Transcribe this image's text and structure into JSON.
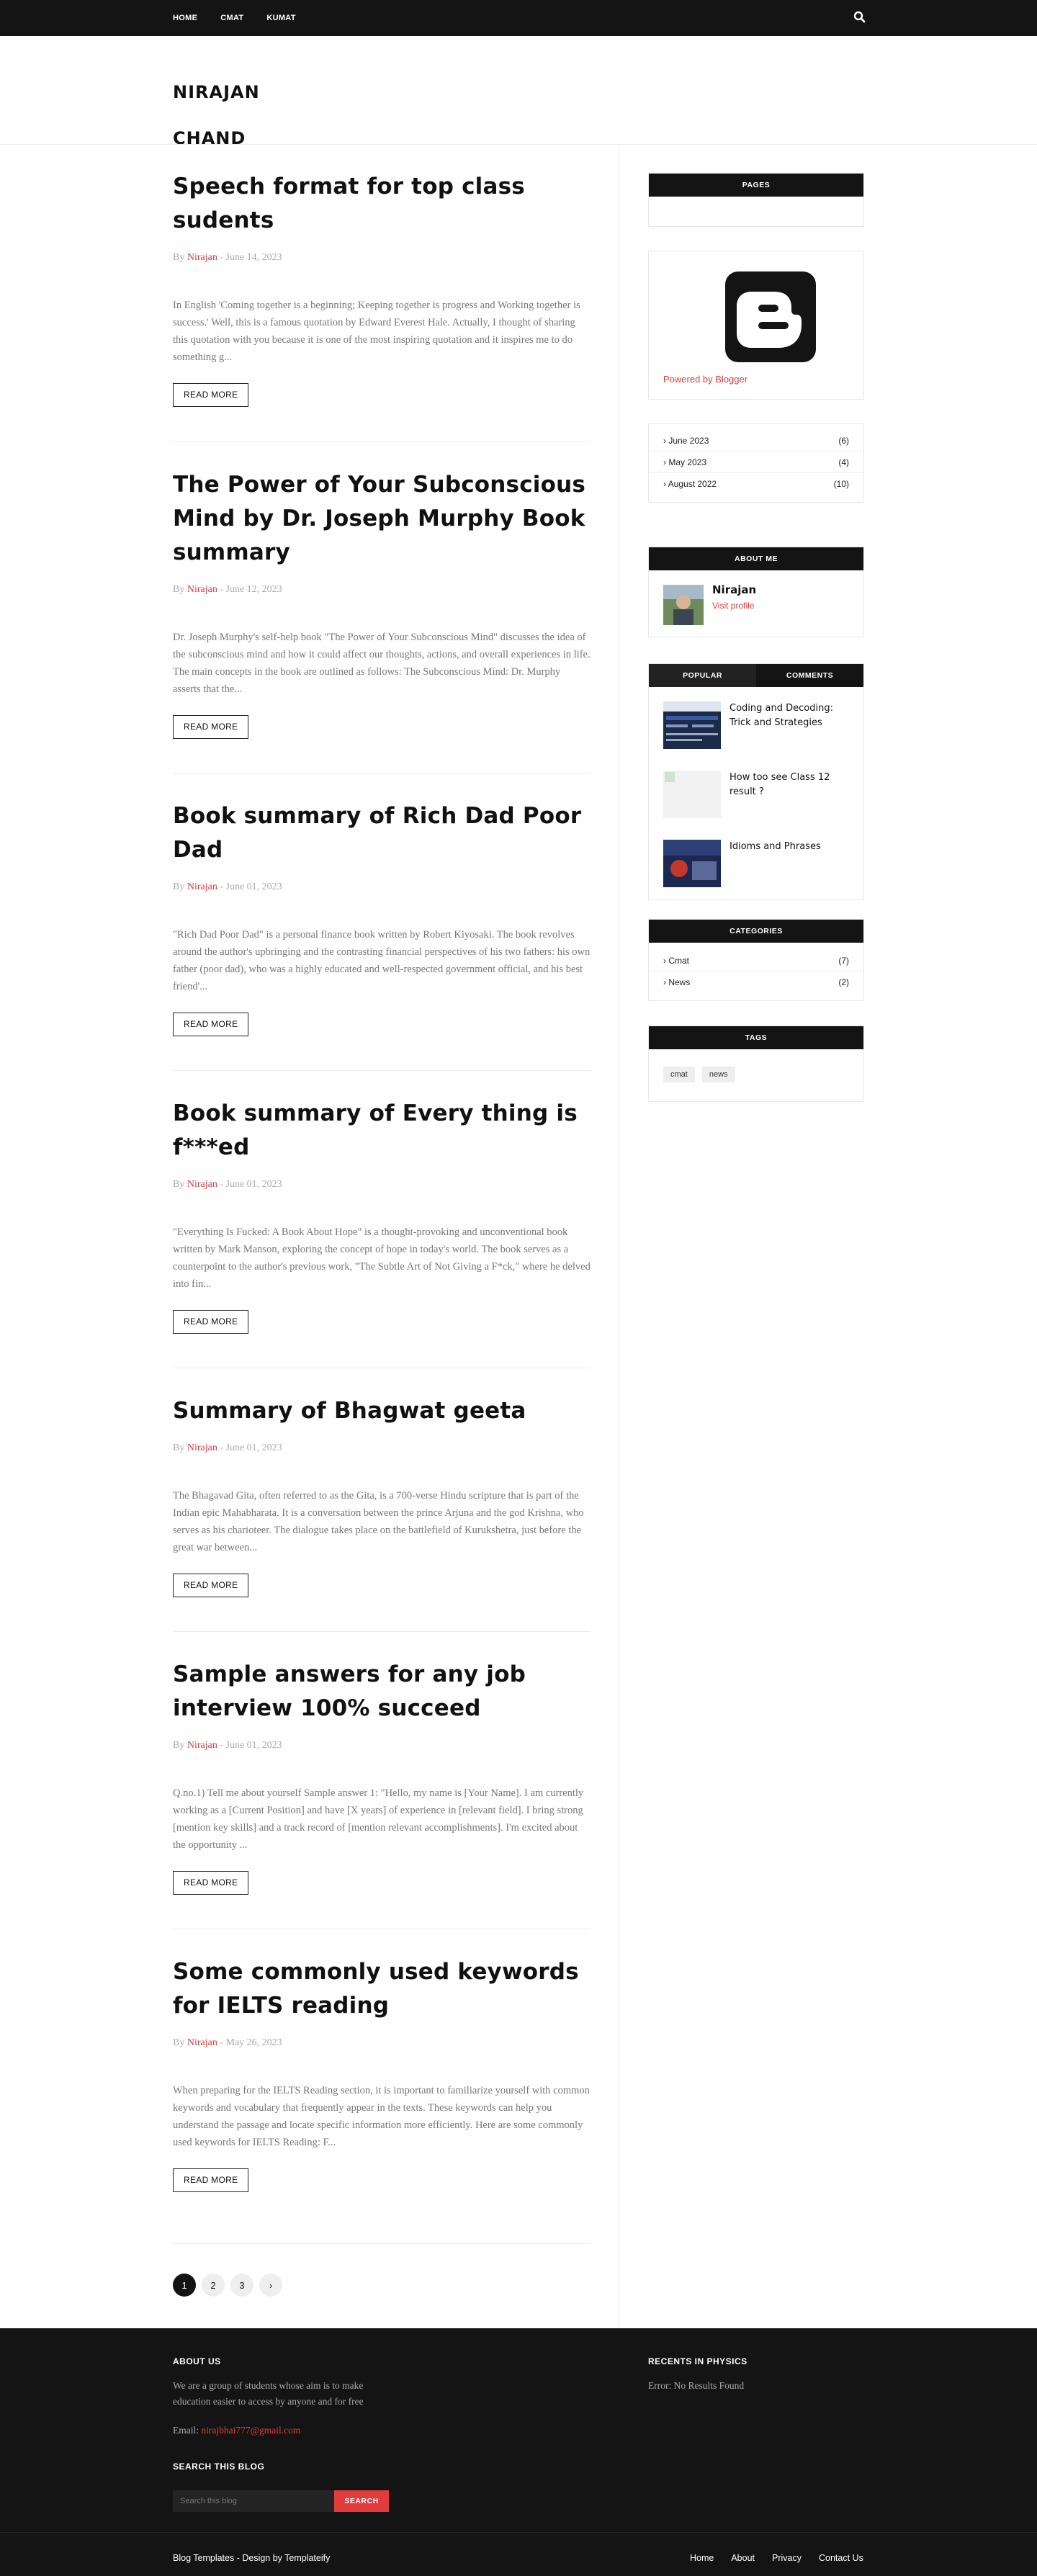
{
  "nav": {
    "items": [
      "HOME",
      "CMAT",
      "KUMAT"
    ],
    "search_icon": "search-icon"
  },
  "site": {
    "title_line1": "NIRAJAN",
    "title_line2": "CHAND"
  },
  "posts": [
    {
      "title": "Speech format for top class sudents",
      "by": "By ",
      "author": "Nirajan",
      "date": " - June 14, 2023",
      "excerpt": "In English 'Coming together is a beginning;  Keeping together is progress and Working together is success.' Well, this is a famous quotation by Edward Everest Hale. Actually, I thought of sharing this quotation with you because it is one of the most inspiring quotation and it inspires me to do something g...",
      "readmore": "READ MORE"
    },
    {
      "title": "The Power of Your Subconscious Mind by Dr. Joseph Murphy Book summary",
      "by": "By ",
      "author": "Nirajan",
      "date": " - June 12, 2023",
      "excerpt": "Dr. Joseph Murphy's self-help book \"The Power of Your Subconscious Mind\" discusses the idea of the subconscious mind and how it could affect our thoughts, actions, and overall experiences in life. The main concepts in the book are outlined as follows: The Subconscious Mind: Dr. Murphy asserts that the...",
      "readmore": "READ MORE"
    },
    {
      "title": "Book summary of Rich Dad Poor Dad",
      "by": "By ",
      "author": "Nirajan",
      "date": " - June 01, 2023",
      "excerpt": "\"Rich Dad Poor Dad\" is a personal finance book written by Robert Kiyosaki. The book revolves around the author's upbringing and the contrasting financial perspectives of his two fathers: his own father (poor dad), who was a highly educated and well-respected government official, and his best friend'...",
      "readmore": "READ MORE"
    },
    {
      "title": "Book summary of Every thing is f***ed",
      "by": "By ",
      "author": "Nirajan",
      "date": " - June 01, 2023",
      "excerpt": "\"Everything Is Fucked: A Book About Hope\" is a thought-provoking and unconventional book written by Mark Manson, exploring the concept of hope in today's world. The book serves as a counterpoint to the author's previous work, \"The Subtle Art of Not Giving a F*ck,\" where he delved into fin...",
      "readmore": "READ MORE"
    },
    {
      "title": "Summary of Bhagwat geeta",
      "by": "By ",
      "author": "Nirajan",
      "date": " - June 01, 2023",
      "excerpt": "The Bhagavad Gita, often referred to as the Gita, is a 700-verse Hindu scripture that is part of the Indian epic Mahabharata. It is a conversation between the prince Arjuna and the god Krishna, who serves as his charioteer. The dialogue takes place on the battlefield of Kurukshetra, just before the great war between...",
      "readmore": "READ MORE"
    },
    {
      "title": "Sample answers for any job interview 100% succeed",
      "by": "By ",
      "author": "Nirajan",
      "date": " - June 01, 2023",
      "excerpt": "Q.no.1) Tell me about yourself Sample answer 1:  \"Hello, my name is [Your Name]. I am currently working as a [Current Position] and have [X years] of experience in [relevant field]. I bring strong [mention key skills] and a track record of [mention relevant accomplishments]. I'm excited about the opportunity ...",
      "readmore": "READ MORE"
    },
    {
      "title": "Some commonly used keywords for IELTS reading",
      "by": "By ",
      "author": "Nirajan",
      "date": " - May 26, 2023",
      "excerpt": "When preparing for the IELTS Reading section, it is important to familiarize yourself with common keywords and vocabulary that frequently appear in the texts. These keywords can help you understand the passage and locate specific information more efficiently. Here are some commonly used keywords for IELTS Reading: F...",
      "readmore": "READ MORE"
    }
  ],
  "pagination": {
    "pages": [
      "1",
      "2",
      "3"
    ],
    "next": "›"
  },
  "sidebar": {
    "pages_title": "PAGES",
    "powered_by": "Powered by Blogger",
    "archive": [
      {
        "label": "› June 2023",
        "count": "(6)"
      },
      {
        "label": "› May 2023",
        "count": "(4)"
      },
      {
        "label": "› August 2022",
        "count": "(10)"
      }
    ],
    "about_title": "ABOUT ME",
    "about_name": "Nirajan",
    "about_link": "Visit profile",
    "tabs": [
      "POPULAR",
      "COMMENTS"
    ],
    "popular": [
      {
        "title": "Coding and Decoding: Trick and Strategies"
      },
      {
        "title": "How too see Class 12 result ?"
      },
      {
        "title": "Idioms and Phrases"
      }
    ],
    "categories_title": "CATEGORIES",
    "categories": [
      {
        "label": "› Cmat",
        "count": "(7)"
      },
      {
        "label": "› News",
        "count": "(2)"
      }
    ],
    "tags_title": "TAGS",
    "tags": [
      "cmat",
      "news"
    ]
  },
  "footer": {
    "about_title": "ABOUT US",
    "about_text": "We are a group of students whose aim is to make education easier to access by anyone and for free",
    "email_label": "Email: ",
    "email_value": "nirajbhai777@gmail.com",
    "search_title": "SEARCH THIS BLOG",
    "search_placeholder": "Search this blog",
    "search_button": "SEARCH",
    "recents_title": "RECENTS IN PHYSICS",
    "recents_text": "Error: No Results Found",
    "credit": "Blog Templates - Design by Templateify",
    "links": [
      "Home",
      "About",
      "Privacy",
      "Contact Us"
    ]
  },
  "colors": {
    "accent": "#e23b3b",
    "dark": "#141414"
  }
}
